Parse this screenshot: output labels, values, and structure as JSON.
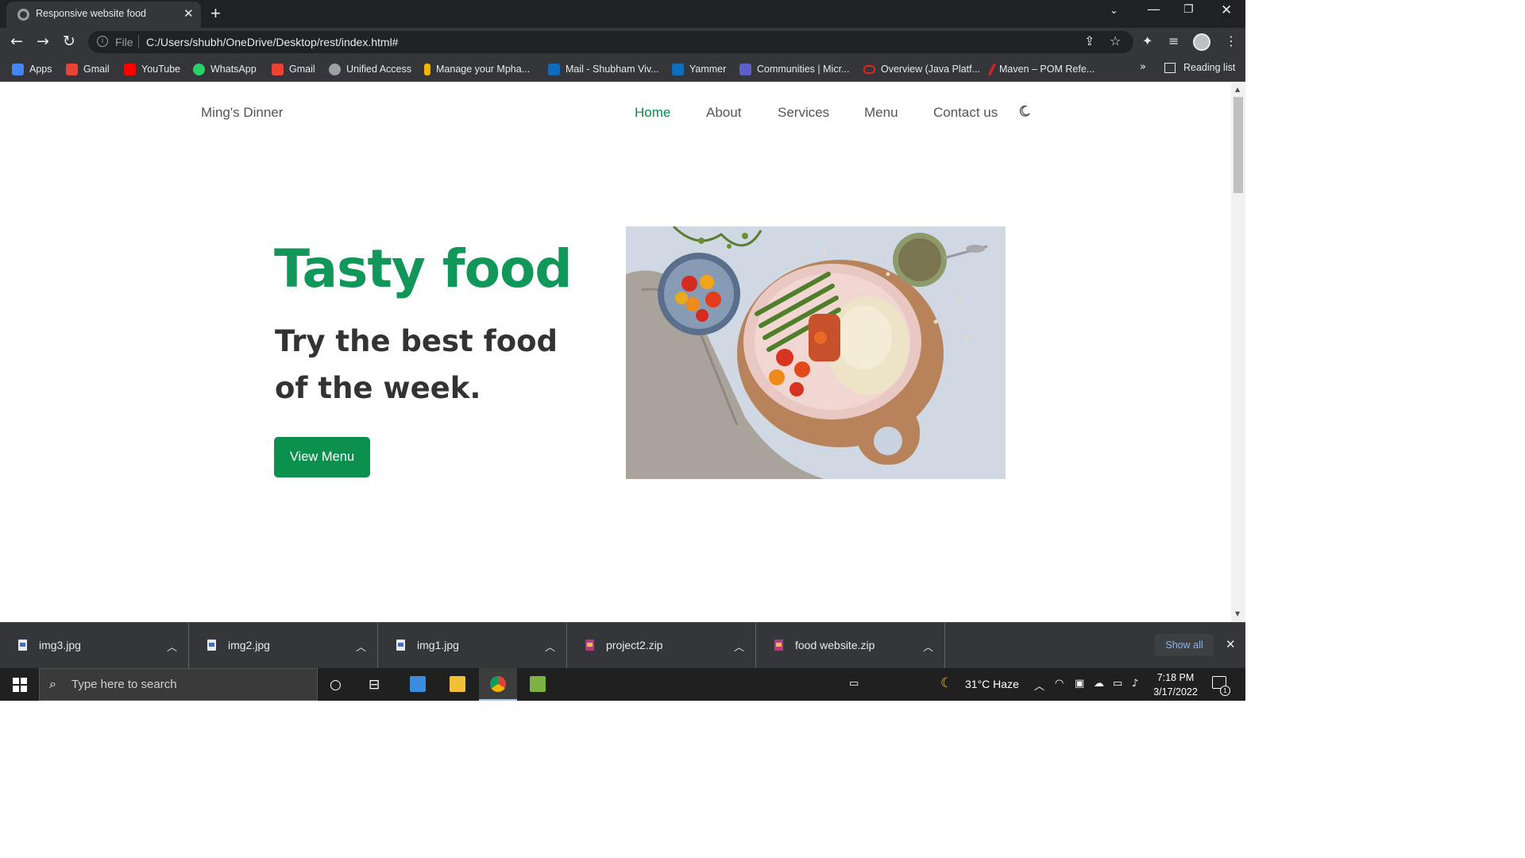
{
  "browser": {
    "tab_title": "Responsive website food",
    "url_scheme_label": "File",
    "url": "C:/Users/shubh/OneDrive/Desktop/rest/index.html#",
    "bookmarks": [
      "Apps",
      "Gmail",
      "YouTube",
      "WhatsApp",
      "Gmail",
      "Unified Access",
      "Manage your Mpha...",
      "Mail - Shubham Viv...",
      "Yammer",
      "Communities | Micr...",
      "Overview (Java Platf...",
      "Maven – POM Refe..."
    ],
    "bookmarks_overflow": "»",
    "reading_list": "Reading list"
  },
  "site": {
    "logo": "Ming's Dinner",
    "nav": [
      "Home",
      "About",
      "Services",
      "Menu",
      "Contact us"
    ],
    "active_nav": "Home",
    "hero_title": "Tasty food",
    "hero_subtitle": "Try the best food of the week.",
    "hero_button": "View Menu",
    "colors": {
      "accent": "#11975a",
      "button": "#0b8f4d",
      "heading": "#333333",
      "nav": "#555555"
    }
  },
  "downloads": {
    "items": [
      "img3.jpg",
      "img2.jpg",
      "img1.jpg",
      "project2.zip",
      "food website.zip"
    ],
    "show_all": "Show all"
  },
  "taskbar": {
    "search_placeholder": "Type here to search",
    "weather": "31°C Haze",
    "time": "7:18 PM",
    "date": "3/17/2022",
    "notification_count": "1"
  },
  "icons": [
    "globe-icon",
    "close-icon",
    "plus-icon",
    "back-arrow-icon",
    "forward-arrow-icon",
    "reload-icon",
    "info-icon",
    "share-icon",
    "star-icon",
    "extensions-icon",
    "media-queue-icon",
    "moon-icon",
    "windows-start-icon",
    "search-icon",
    "cortana-icon",
    "task-view-icon"
  ]
}
